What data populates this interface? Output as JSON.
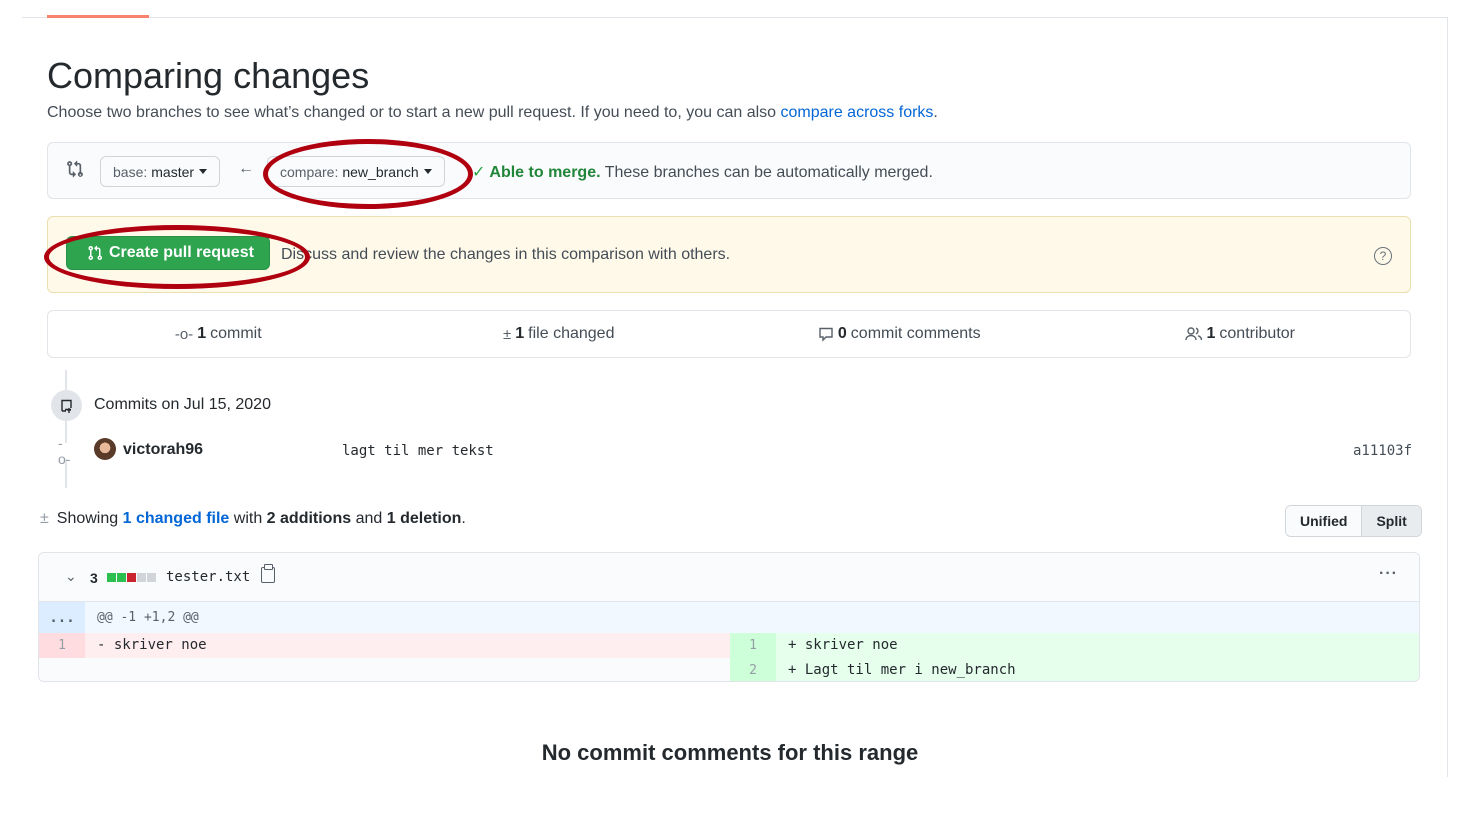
{
  "page": {
    "title": "Comparing changes",
    "subtitle_text": "Choose two branches to see what’s changed or to start a new pull request. If you need to, you can also ",
    "subtitle_link": "compare across forks",
    "subtitle_end": "."
  },
  "range": {
    "base_prefix": "base:",
    "base_branch": "master",
    "compare_prefix": "compare:",
    "compare_branch": "new_branch",
    "merge_check": "✓",
    "merge_status": "Able to merge.",
    "merge_detail": "These branches can be automatically merged."
  },
  "create": {
    "button_label": "Create pull request",
    "description": "Discuss and review the changes in this comparison with others.",
    "help": "?"
  },
  "summary": {
    "commits_count": "1",
    "commits_label": "commit",
    "files_count": "1",
    "files_label": "file changed",
    "comments_count": "0",
    "comments_label": "commit comments",
    "contributors_count": "1",
    "contributors_label": "contributor"
  },
  "commits": {
    "date_heading": "Commits on Jul 15, 2020",
    "items": [
      {
        "author": "victorah96",
        "message": "lagt til mer tekst",
        "sha": "a11103f"
      }
    ]
  },
  "diff": {
    "showing": "Showing",
    "changed_link": "1 changed file",
    "with": "with",
    "additions": "2 additions",
    "and": "and",
    "deletions": "1 deletion",
    "end": ".",
    "view_unified": "Unified",
    "view_split": "Split",
    "file": {
      "change_count": "3",
      "name": "tester.txt",
      "hunk_expand": "...",
      "hunk_header": "@@ -1 +1,2 @@",
      "left_lines": [
        {
          "num": "1",
          "code": "- skriver noe"
        }
      ],
      "right_lines": [
        {
          "num": "1",
          "code": "+ skriver noe"
        },
        {
          "num": "2",
          "code": "+ Lagt til mer i new_branch"
        }
      ],
      "diffstat": [
        "add",
        "add",
        "del",
        "neutral",
        "neutral"
      ]
    }
  },
  "footer": {
    "no_comments": "No commit comments for this range"
  },
  "colors": {
    "accent_green": "#2ea44f",
    "link_blue": "#0366d6",
    "annotation_red": "#b0000f"
  }
}
